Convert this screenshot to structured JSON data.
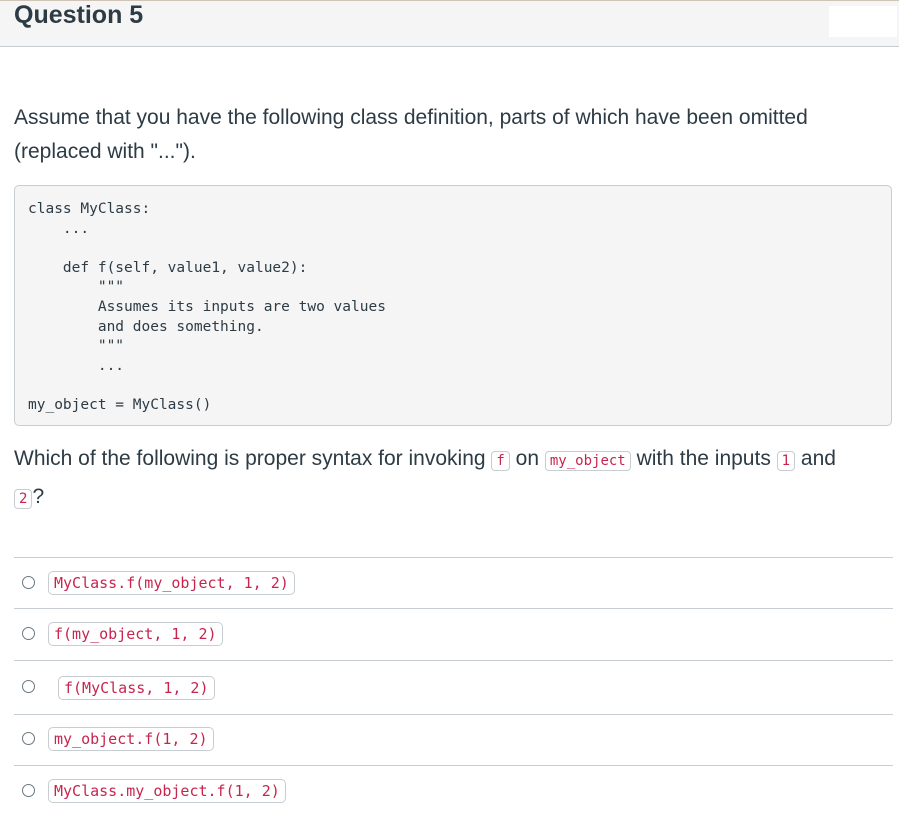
{
  "question": {
    "title": "Question 5",
    "prompt": "Assume that you have the following class definition, parts of which have been omitted (replaced with \"...\").",
    "code": "class MyClass:\n    ...\n\n    def f(self, value1, value2):\n        \"\"\"\n        Assumes its inputs are two values\n        and does something.\n        \"\"\"\n        ...\n\nmy_object = MyClass()",
    "ask_parts": [
      "Which of the following is proper syntax for invoking ",
      " on ",
      " with the inputs ",
      " and ",
      "?"
    ],
    "ask_codes": [
      "f",
      "my_object",
      "1",
      "2"
    ]
  },
  "answers": [
    {
      "label": "MyClass.f(my_object, 1, 2)"
    },
    {
      "label": "f(my_object, 1, 2)"
    },
    {
      "label": "f(MyClass, 1, 2)"
    },
    {
      "label": "my_object.f(1, 2)"
    },
    {
      "label": "MyClass.my_object.f(1, 2)"
    }
  ],
  "colors": {
    "text": "#2d3b45",
    "code_text": "#c7254e",
    "border": "#c7cdd1",
    "header_bg": "#f5f5f5"
  }
}
